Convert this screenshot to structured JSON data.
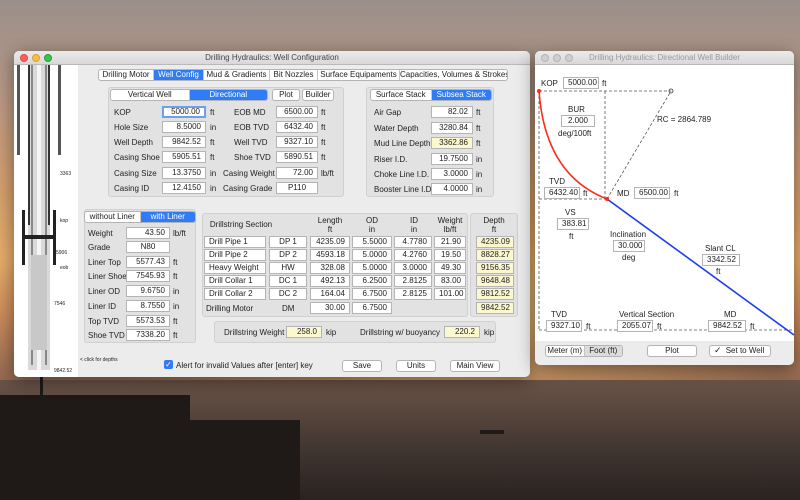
{
  "colors": {
    "accent": "#2f7cf6",
    "highlight_field": "#fbf7cf",
    "red_curve": "#ff2a1a",
    "blue_line": "#1f3ef2"
  },
  "main_window": {
    "title": "Drilling Hydraulics: Well Configuration",
    "tabs": [
      "Drilling Motor",
      "Well Config",
      "Mud & Gradients",
      "Bit Nozzles",
      "Surface Equipaments",
      "Capacities, Volumes & Strokes"
    ],
    "active_tab": "Well Config",
    "well_type": {
      "options": [
        "Vertical Well",
        "Directional"
      ],
      "selected": "Directional",
      "plot": "Plot",
      "builder": "Builder"
    },
    "well_fields": [
      {
        "label": "KOP",
        "value": "5000.00",
        "unit": "ft"
      },
      {
        "label": "Hole Size",
        "value": "8.5000",
        "unit": "in"
      },
      {
        "label": "Well Depth",
        "value": "9842.52",
        "unit": "ft"
      },
      {
        "label": "Casing Shoe",
        "value": "5905.51",
        "unit": "ft"
      },
      {
        "label": "Casing Size",
        "value": "13.3750",
        "unit": "in"
      },
      {
        "label": "Casing ID",
        "value": "12.4150",
        "unit": "in"
      }
    ],
    "eob_fields": [
      {
        "label": "EOB MD",
        "value": "6500.00",
        "unit": "ft"
      },
      {
        "label": "EOB TVD",
        "value": "6432.40",
        "unit": "ft"
      },
      {
        "label": "Well TVD",
        "value": "9327.10",
        "unit": "ft"
      },
      {
        "label": "Shoe TVD",
        "value": "5890.51",
        "unit": "ft"
      },
      {
        "label": "Casing Weight",
        "value": "72.00",
        "unit": "lb/ft"
      },
      {
        "label": "Casing Grade",
        "value": "P110",
        "unit": ""
      }
    ],
    "stack": {
      "options": [
        "Surface Stack",
        "Subsea Stack"
      ],
      "selected": "Subsea Stack"
    },
    "stack_fields": [
      {
        "label": "Air Gap",
        "value": "82.02",
        "unit": "ft"
      },
      {
        "label": "Water Depth",
        "value": "3280.84",
        "unit": "ft"
      },
      {
        "label": "Mud Line Depth",
        "value": "3362.86",
        "unit": "ft"
      },
      {
        "label": "Riser I.D.",
        "value": "19.7500",
        "unit": "in"
      },
      {
        "label": "Choke Line I.D.",
        "value": "3.0000",
        "unit": "in"
      },
      {
        "label": "Booster Line I.D.",
        "value": "4.0000",
        "unit": "in"
      }
    ],
    "liner": {
      "options": [
        "without Liner",
        "with Liner"
      ],
      "selected": "with Liner"
    },
    "liner_fields": [
      {
        "label": "Weight",
        "value": "43.50",
        "unit": "lb/ft"
      },
      {
        "label": "Grade",
        "value": "N80",
        "unit": ""
      },
      {
        "label": "Liner Top",
        "value": "5577.43",
        "unit": "ft"
      },
      {
        "label": "Liner Shoe",
        "value": "7545.93",
        "unit": "ft"
      },
      {
        "label": "Liner OD",
        "value": "9.6750",
        "unit": "in"
      },
      {
        "label": "Liner ID",
        "value": "8.7550",
        "unit": "in"
      },
      {
        "label": "Top TVD",
        "value": "5573.53",
        "unit": "ft"
      },
      {
        "label": "Shoe TVD",
        "value": "7338.20",
        "unit": "ft"
      }
    ],
    "drillstring": {
      "headers": [
        [
          "Drillstring Section",
          ""
        ],
        [
          "Length",
          "ft"
        ],
        [
          "OD",
          "in"
        ],
        [
          "ID",
          "in"
        ],
        [
          "Weight",
          "lb/ft"
        ],
        [
          "Depth",
          "ft"
        ]
      ],
      "rows": [
        {
          "name": "Drill Pipe 1",
          "code": "DP 1",
          "length": "4235.09",
          "od": "5.5000",
          "id": "4.7780",
          "weight": "21.90",
          "depth": "4235.09"
        },
        {
          "name": "Drill Pipe 2",
          "code": "DP 2",
          "length": "4593.18",
          "od": "5.0000",
          "id": "4.2760",
          "weight": "19.50",
          "depth": "8828.27"
        },
        {
          "name": "Heavy Weight",
          "code": "HW",
          "length": "328.08",
          "od": "5.0000",
          "id": "3.0000",
          "weight": "49.30",
          "depth": "9156.35"
        },
        {
          "name": "Drill Collar 1",
          "code": "DC 1",
          "length": "492.13",
          "od": "6.2500",
          "id": "2.8125",
          "weight": "83.00",
          "depth": "9648.48"
        },
        {
          "name": "Drill Collar 2",
          "code": "DC 2",
          "length": "164.04",
          "od": "6.7500",
          "id": "2.8125",
          "weight": "101.00",
          "depth": "9812.52"
        },
        {
          "name": "Drilling Motor",
          "code": "DM",
          "length": "30.00",
          "od": "6.7500",
          "id": "",
          "weight": "",
          "depth": "9842.52"
        }
      ]
    },
    "weights": {
      "drillstring_label": "Drillstring Weight",
      "drillstring_value": "258.0",
      "buoy_label": "Drillstring w/ buoyancy",
      "buoy_value": "220.2",
      "unit": "kip"
    },
    "ruler": {
      "marks": [
        "3363",
        "kop",
        "5906",
        "eob",
        "7546",
        "9842.52"
      ],
      "hint": "< click for depths"
    },
    "alert_checkbox": {
      "label": "Alert for invalid Values after [enter] key",
      "checked": true
    },
    "buttons": {
      "save": "Save",
      "units": "Units",
      "main_view": "Main View"
    }
  },
  "builder_window": {
    "title": "Drilling Hydraulics: Directional Well Builder",
    "kop_label": "KOP",
    "kop_value": "5000.00",
    "kop_unit": "ft",
    "bur_label": "BUR",
    "bur_value": "2.000",
    "bur_unit": "deg/100ft",
    "rc_text": "RC = 2864.789",
    "tvd_eob_label": "TVD",
    "tvd_eob_value": "6432.40",
    "tvd_eob_unit": "ft",
    "md_eob_label": "MD",
    "md_eob_value": "6500.00",
    "md_eob_unit": "ft",
    "vs_label": "VS",
    "vs_value": "383.81",
    "vs_unit": "ft",
    "inclination_label": "Inclination",
    "inclination_value": "30.000",
    "inclination_unit": "deg",
    "slant_label": "Slant CL",
    "slant_value": "3342.52",
    "slant_unit": "ft",
    "tvd_label": "TVD",
    "tvd_value": "9327.10",
    "tvd_unit": "ft",
    "vsec_label": "Vertical Section",
    "vsec_value": "2055.07",
    "vsec_unit": "ft",
    "md_label": "MD",
    "md_value": "9842.52",
    "md_unit": "ft",
    "unit_options": [
      "Meter (m)",
      "Foot (ft)"
    ],
    "unit_selected": "Foot (ft)",
    "plot_button": "Plot",
    "set_button": "Set to Well"
  }
}
